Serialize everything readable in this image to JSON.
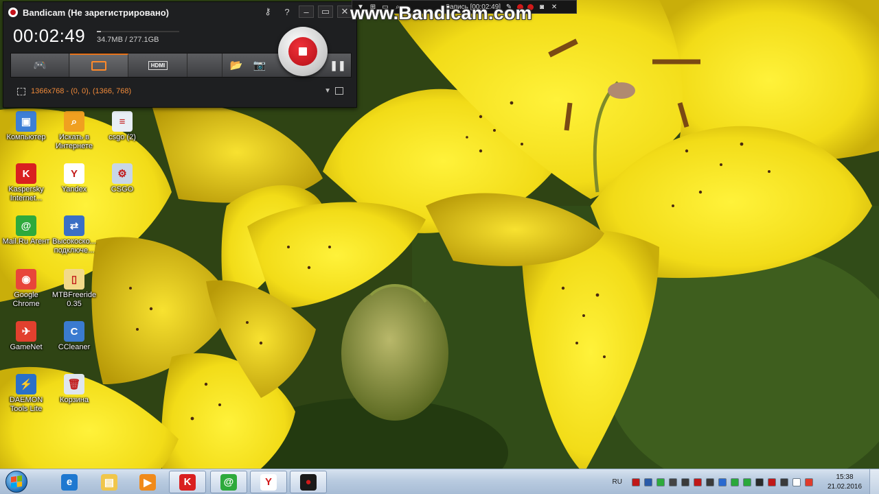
{
  "watermark": "www.Bandicam.com",
  "minibar": {
    "text": "Запись [00:02:49]"
  },
  "bandicam": {
    "title": "Bandicam (Не зарегистрировано)",
    "timer": "00:02:49",
    "file_size": "34.7MB / 277.1GB",
    "file_size_fraction": 0.05,
    "resolution": "1366x768 - (0, 0), (1366, 768)",
    "modes": [
      {
        "name": "game-mode",
        "icon": "gamepad-icon",
        "active": false
      },
      {
        "name": "screen-mode",
        "icon": "screen-rect-icon",
        "active": true
      },
      {
        "name": "device-mode",
        "icon": "hdmi-icon",
        "label": "HDMI",
        "active": false
      }
    ],
    "title_buttons": [
      "key-icon",
      "help-icon",
      "minimize-icon",
      "restore-icon",
      "close-icon"
    ],
    "accent_color": "#e8731a",
    "record_color": "#d21a1a"
  },
  "desktop_icons": [
    {
      "id": "computer",
      "label": "Компьютер",
      "icon": "computer-icon",
      "color": "#3d7fd6",
      "glyph": "▣"
    },
    {
      "id": "search-internet",
      "label": "Искать в Интернете",
      "icon": "search-icon",
      "color": "#f0a020",
      "glyph": "⌕"
    },
    {
      "id": "csgo2",
      "label": "csgo (2)",
      "icon": "file-icon",
      "color": "#e8eef5",
      "glyph": "≡"
    },
    {
      "id": "kaspersky",
      "label": "Kaspersky Internet...",
      "icon": "kaspersky-icon",
      "color": "#d92020",
      "glyph": "K"
    },
    {
      "id": "yandex",
      "label": "Yandex",
      "icon": "yandex-icon",
      "color": "#ffffff",
      "glyph": "Y"
    },
    {
      "id": "csgo",
      "label": "CSGO",
      "icon": "csgo-icon",
      "color": "#c8d6e6",
      "glyph": "⚙"
    },
    {
      "id": "mailru",
      "label": "Mail.Ru Агент",
      "icon": "mailru-agent-icon",
      "color": "#2eaa3c",
      "glyph": "@"
    },
    {
      "id": "highspeed",
      "label": "Высокоско... подключе...",
      "icon": "network-connection-icon",
      "color": "#3a6fc4",
      "glyph": "⇄"
    },
    {
      "id": "chrome",
      "label": "Google Chrome",
      "icon": "chrome-icon",
      "color": "#e8463a",
      "glyph": "◉"
    },
    {
      "id": "mtbfreeride",
      "label": "MTBFreeride 0.35",
      "icon": "folder-icon",
      "color": "#f2d98a",
      "glyph": "▯"
    },
    {
      "id": "gamenet",
      "label": "GameNet",
      "icon": "gamenet-icon",
      "color": "#e2402e",
      "glyph": "✈"
    },
    {
      "id": "ccleaner",
      "label": "CCleaner",
      "icon": "ccleaner-icon",
      "color": "#3a7bd0",
      "glyph": "C"
    },
    {
      "id": "daemon",
      "label": "DAEMON Tools Lite",
      "icon": "daemon-tools-icon",
      "color": "#2a70c8",
      "glyph": "⚡"
    },
    {
      "id": "recycle",
      "label": "Корзина",
      "icon": "recycle-bin-icon",
      "color": "#dfe6ee",
      "glyph": "🗑"
    }
  ],
  "taskbar": {
    "items": [
      {
        "id": "ie",
        "icon": "internet-explorer-icon",
        "color": "#1e78d0",
        "glyph": "e",
        "open": false
      },
      {
        "id": "explorer",
        "icon": "explorer-folder-icon",
        "color": "#f0c64a",
        "glyph": "▤",
        "open": false
      },
      {
        "id": "media",
        "icon": "media-player-icon",
        "color": "#f08a1a",
        "glyph": "▶",
        "open": false
      },
      {
        "id": "kaspersky",
        "icon": "kaspersky-icon",
        "color": "#d92020",
        "glyph": "K",
        "open": true
      },
      {
        "id": "mailru",
        "icon": "mailru-agent-icon",
        "color": "#2eaa3c",
        "glyph": "@",
        "open": true
      },
      {
        "id": "yandex",
        "icon": "yandex-icon",
        "color": "#ffffff",
        "glyph": "Y",
        "open": true
      },
      {
        "id": "bandicam",
        "icon": "bandicam-icon",
        "color": "#1a1a1a",
        "glyph": "●",
        "open": true
      }
    ],
    "lang": "RU",
    "time": "15:38",
    "date": "21.02.2016",
    "tray_icons": [
      {
        "icon": "record-tray-icon",
        "color": "#c01818"
      },
      {
        "icon": "bluetooth-tray-icon",
        "color": "#2a5aa8"
      },
      {
        "icon": "mailru-tray-icon",
        "color": "#2eaa3c"
      },
      {
        "icon": "network-tray-icon",
        "color": "#444444"
      },
      {
        "icon": "sound-tray-icon",
        "color": "#3a3a3a"
      },
      {
        "icon": "kaspersky-tray-icon",
        "color": "#c01818"
      },
      {
        "icon": "steam-tray-icon",
        "color": "#3a3a3a"
      },
      {
        "icon": "security-tray-icon",
        "color": "#2a6ad0"
      },
      {
        "icon": "update-tray-icon",
        "color": "#2aa83a"
      },
      {
        "icon": "battery-tray-icon",
        "color": "#2aa83a"
      },
      {
        "icon": "power-tray-icon",
        "color": "#2a2a2a"
      },
      {
        "icon": "acrobat-tray-icon",
        "color": "#c01818"
      },
      {
        "icon": "volume-tray-icon",
        "color": "#3a3a3a"
      },
      {
        "icon": "flag-tray-icon",
        "color": "#ffffff"
      },
      {
        "icon": "warning-tray-icon",
        "color": "#e03a2a"
      }
    ]
  }
}
